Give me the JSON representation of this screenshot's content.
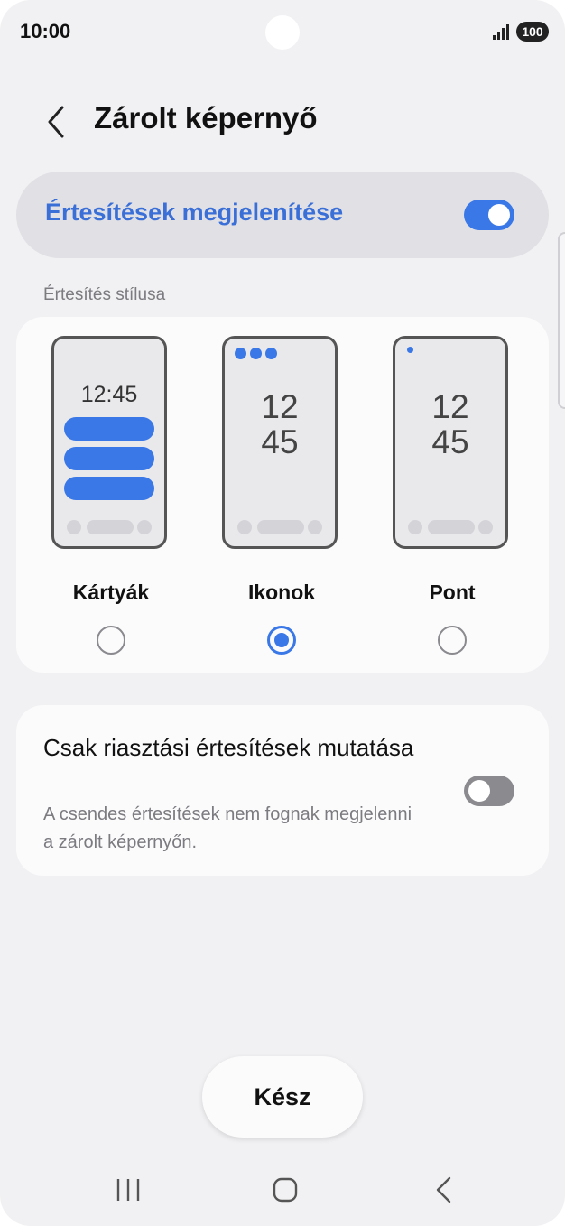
{
  "status_bar": {
    "time": "10:00",
    "battery": "100"
  },
  "header": {
    "title": "Zárolt képernyő",
    "back_icon": "chevron-left-icon"
  },
  "master_toggle": {
    "label": "Értesítések megjelenítése",
    "on": true
  },
  "style_section": {
    "label": "Értesítés stílusa",
    "options": [
      {
        "label": "Kártyák",
        "preview_clock": "12:45",
        "selected": false
      },
      {
        "label": "Ikonok",
        "preview_clock_line1": "12",
        "preview_clock_line2": "45",
        "selected": true
      },
      {
        "label": "Pont",
        "preview_clock_line1": "12",
        "preview_clock_line2": "45",
        "selected": false
      }
    ]
  },
  "alert_only": {
    "title": "Csak riasztási értesítések mutatása",
    "description": "A csendes értesítések nem fognak megjelenni a zárolt képernyőn.",
    "on": false
  },
  "done_button": {
    "label": "Kész"
  },
  "navbar": {
    "recents_icon": "recents-icon",
    "home_icon": "home-icon",
    "back_icon": "back-icon"
  },
  "colors": {
    "accent": "#3a78e8",
    "background": "#f1f1f3",
    "card": "#fbfbfc"
  }
}
